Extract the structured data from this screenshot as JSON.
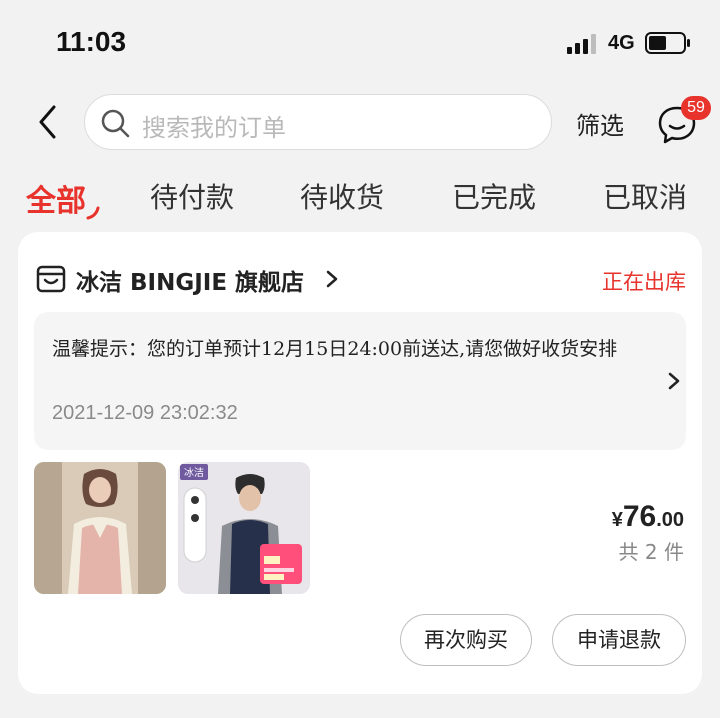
{
  "status_bar": {
    "time": "11:03",
    "network": "4G",
    "battery_level": 0.5
  },
  "header": {
    "search_placeholder": "搜索我的订单",
    "filter_label": "筛选",
    "messages_badge": "59"
  },
  "tabs": [
    {
      "label": "全部",
      "active": true
    },
    {
      "label": "待付款",
      "active": false
    },
    {
      "label": "待收货",
      "active": false
    },
    {
      "label": "已完成",
      "active": false
    },
    {
      "label": "已取消",
      "active": false
    }
  ],
  "order": {
    "shop_name": "冰洁 BINGJIE 旗舰店",
    "status": "正在出库",
    "notice_text": "温馨提示：您的订单预计12月15日24:00前送达,请您做好收货安排",
    "notice_time": "2021-12-09 23:02:32",
    "price_currency": "¥",
    "price_integer": "76",
    "price_decimal": ".00",
    "item_count": "共 2 件",
    "product2_brand": "冰洁",
    "buttons": {
      "rebuy": "再次购买",
      "refund": "申请退款"
    }
  },
  "colors": {
    "accent": "#e8332c",
    "background": "#f2f2f2"
  }
}
